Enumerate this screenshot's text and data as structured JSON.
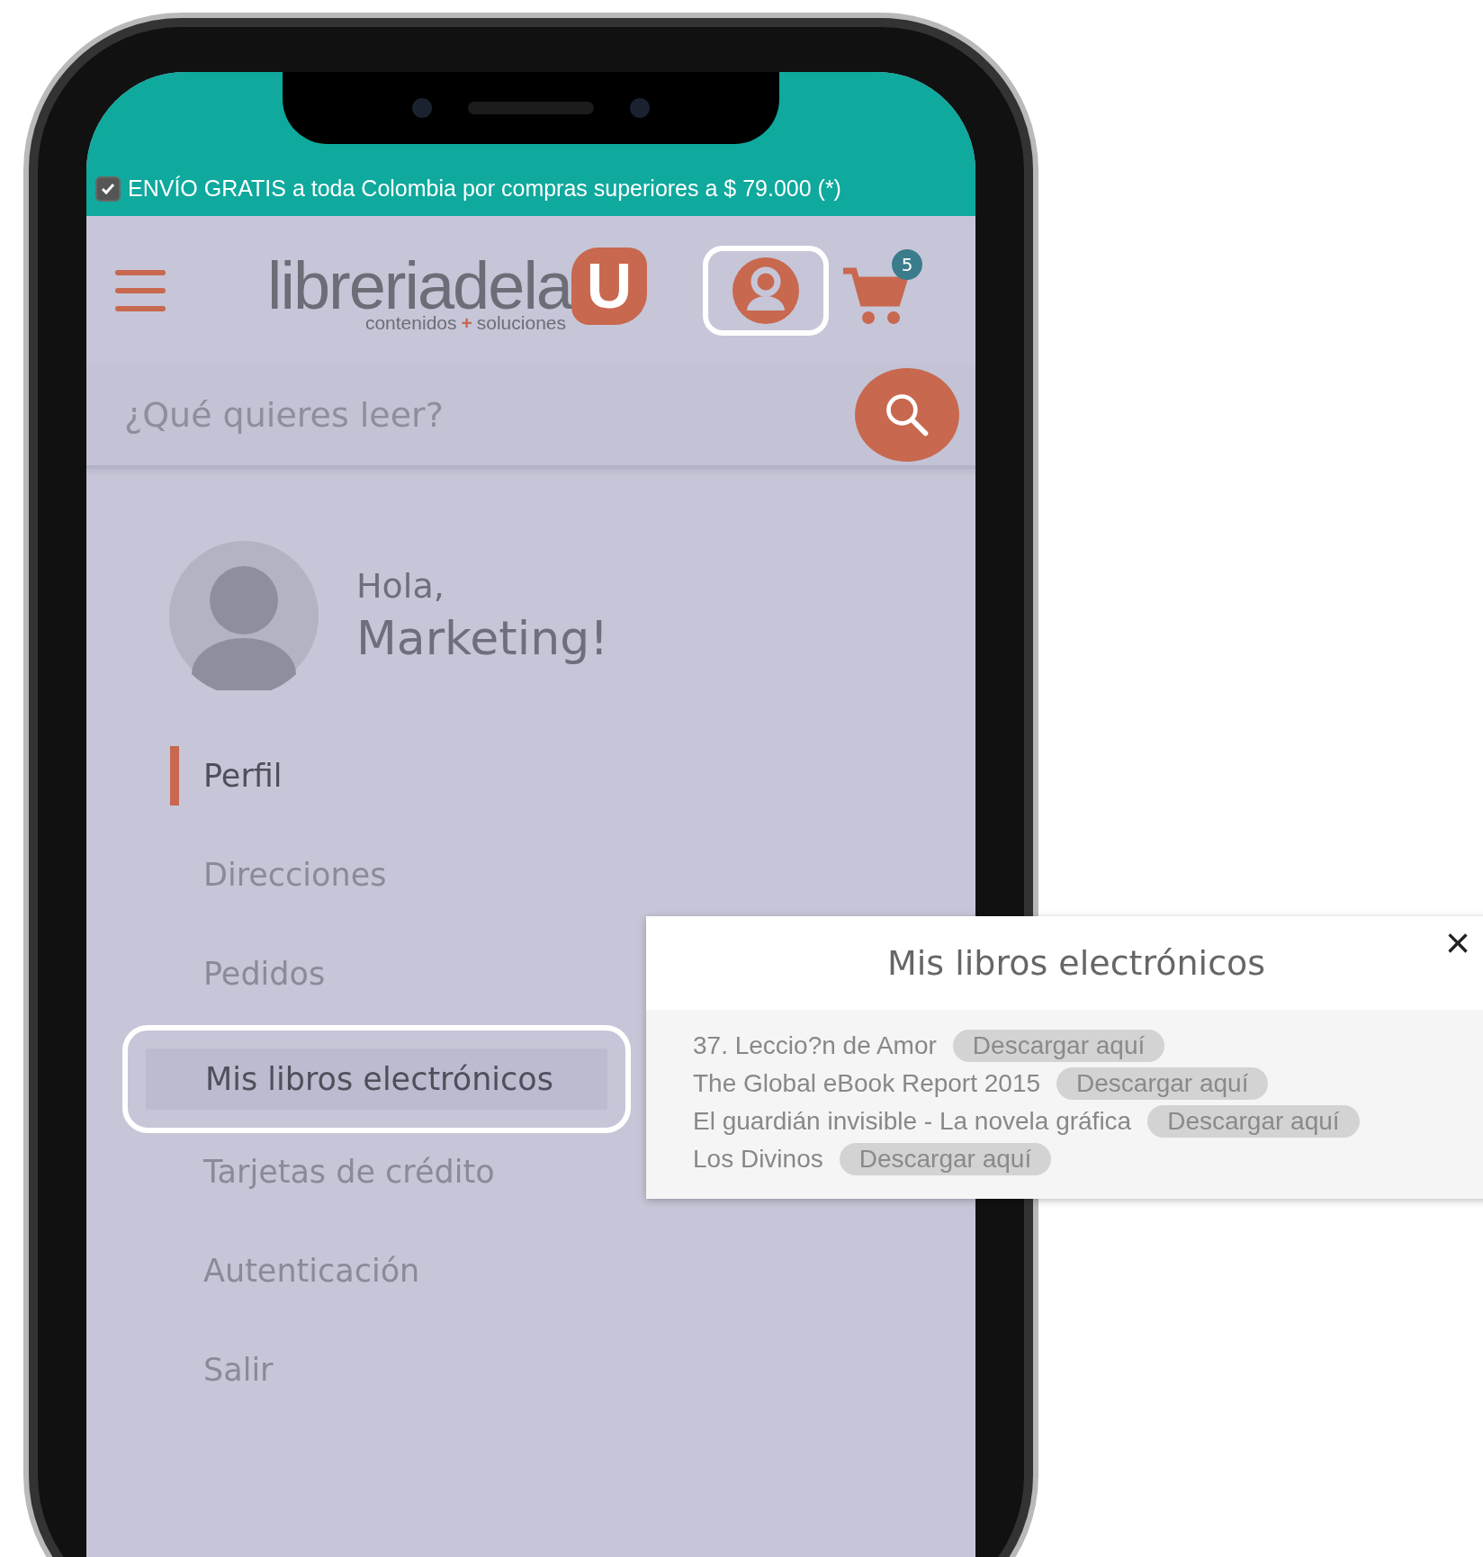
{
  "banner": {
    "checked": true,
    "text": "ENVÍO GRATIS a toda Colombia por compras superiores a $ 79.000 (*)"
  },
  "header": {
    "logo_text": "libreriadela",
    "logo_letter": "U",
    "tagline_left": "contenidos",
    "tagline_plus": "+",
    "tagline_right": "soluciones",
    "account_highlighted": true,
    "cart_count": "5"
  },
  "search": {
    "placeholder": "¿Qué quieres leer?"
  },
  "profile": {
    "greeting": "Hola,",
    "name": "Marketing!"
  },
  "menu": [
    {
      "label": "Perfil",
      "selected": true,
      "highlighted": false
    },
    {
      "label": "Direcciones",
      "selected": false,
      "highlighted": false
    },
    {
      "label": "Pedidos",
      "selected": false,
      "highlighted": false
    },
    {
      "label": "Mis libros electrónicos",
      "selected": false,
      "highlighted": true
    },
    {
      "label": "Tarjetas de crédito",
      "selected": false,
      "highlighted": false
    },
    {
      "label": "Autenticación",
      "selected": false,
      "highlighted": false
    },
    {
      "label": "Salir",
      "selected": false,
      "highlighted": false
    }
  ],
  "popup": {
    "title": "Mis libros electrónicos",
    "close": "×",
    "books": [
      {
        "title": "37. Leccio?n de Amor",
        "button": "Descargar aquí"
      },
      {
        "title": "The Global eBook Report 2015",
        "button": "Descargar aquí"
      },
      {
        "title": "El guardián invisible - La novela gráfica",
        "button": "Descargar aquí"
      },
      {
        "title": "Los Divinos",
        "button": "Descargar aquí"
      }
    ]
  }
}
